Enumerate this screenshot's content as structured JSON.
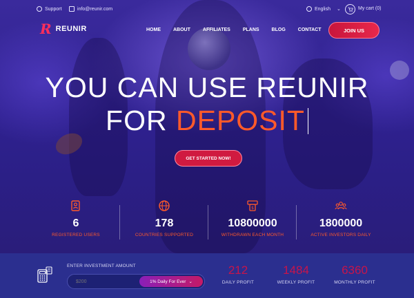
{
  "topbar": {
    "support": "Support",
    "email": "info@reunir.com",
    "language": "English",
    "cart": "My cart (0)"
  },
  "nav": {
    "logo_mark": "R",
    "logo_text": "REUNIR",
    "menu": [
      "HOME",
      "ABOUT",
      "AFFILIATES",
      "PLANS",
      "BLOG",
      "CONTACT"
    ],
    "join_label": "JOIN US"
  },
  "hero": {
    "line1": "YOU CAN USE REUNIR",
    "line2_prefix": "FOR",
    "line2_highlight": "DEPOSIT",
    "cta_label": "GET STARTED NOW!"
  },
  "stats": [
    {
      "icon": "users-list-icon",
      "value": "6",
      "label": "REGISTERED USERS"
    },
    {
      "icon": "globe-icon",
      "value": "178",
      "label": "COUNTRIES SUPPORTED"
    },
    {
      "icon": "money-withdraw-icon",
      "value": "10800000",
      "label": "WITHDRAWN EACH MONTH"
    },
    {
      "icon": "investors-group-icon",
      "value": "1800000",
      "label": "ACTIVE INVESTORS DAILY"
    }
  ],
  "calculator": {
    "label": "ENTER INVESTMENT AMOUNT",
    "placeholder": "$200",
    "plan_selected": "1% Daily For Ever",
    "profits": [
      {
        "value": "212",
        "label": "DAILY PROFIT"
      },
      {
        "value": "1484",
        "label": "WEEKLY PROFIT"
      },
      {
        "value": "6360",
        "label": "MONTHLY PROFIT"
      }
    ]
  },
  "colors": {
    "accent_orange": "#ff5a2a",
    "accent_red": "#d01a40",
    "hero_bg": "#2f2190",
    "bottom_bg": "#2b2f8f"
  }
}
